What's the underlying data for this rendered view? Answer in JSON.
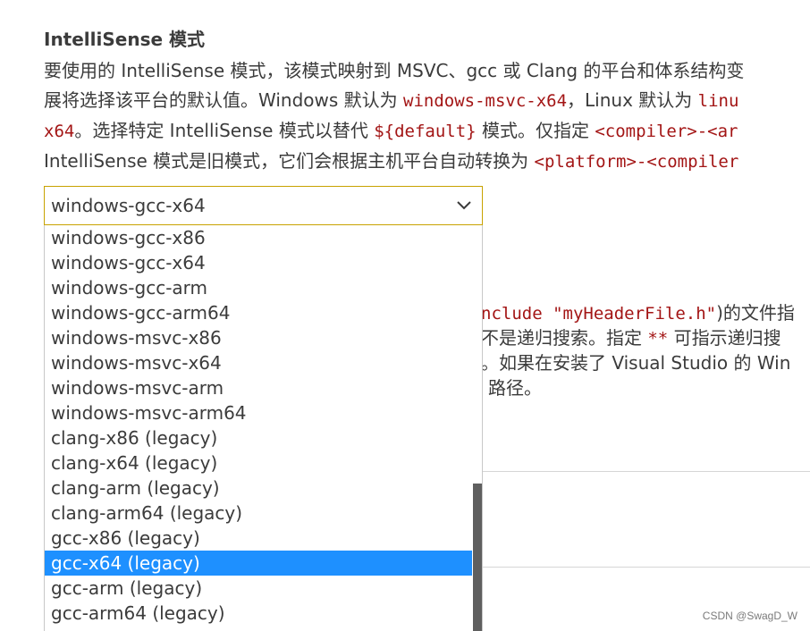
{
  "setting": {
    "title": "IntelliSense 模式",
    "desc_line1": "要使用的 IntelliSense 模式，该模式映射到 MSVC、gcc 或 Clang 的平台和体系结构变",
    "desc_line2_a": "展将选择该平台的默认值。Windows 默认为 ",
    "desc_line2_code1": "windows-msvc-x64",
    "desc_line2_b": "，Linux 默认为 ",
    "desc_line2_code2": "linu",
    "desc_line3_code1": "x64",
    "desc_line3_a": "。选择特定 IntelliSense 模式以替代 ",
    "desc_line3_code2": "${default}",
    "desc_line3_b": " 模式。仅指定 ",
    "desc_line3_code3": "<compiler>-<ar",
    "desc_line4_a": "IntelliSense 模式是旧模式，它们会根据主机平台自动转换为 ",
    "desc_line4_code": "<platform>-<compiler"
  },
  "select": {
    "value": "windows-gcc-x64",
    "chevron_icon": "chevron-down-icon"
  },
  "dropdown": {
    "options": [
      "windows-gcc-x86",
      "windows-gcc-x64",
      "windows-gcc-arm",
      "windows-gcc-arm64",
      "windows-msvc-x86",
      "windows-msvc-x64",
      "windows-msvc-arm",
      "windows-msvc-arm64",
      "clang-x86 (legacy)",
      "clang-x64 (legacy)",
      "clang-arm (legacy)",
      "clang-arm64 (legacy)",
      "gcc-x86 (legacy)",
      "gcc-x64 (legacy)",
      "gcc-arm (legacy)",
      "gcc-arm64 (legacy)"
    ],
    "selected_index": 13
  },
  "background": {
    "line1_code": "nclude \"myHeaderFile.h\"",
    "line1_text": ")的文件指",
    "line2_a": "不是递归搜索。指定 ",
    "line2_code": "**",
    "line2_b": " 可指示递归搜",
    "line3": "。如果在安装了 Visual Studio 的 Win",
    "line4": "路径。"
  },
  "watermark": "CSDN @SwagD_W"
}
